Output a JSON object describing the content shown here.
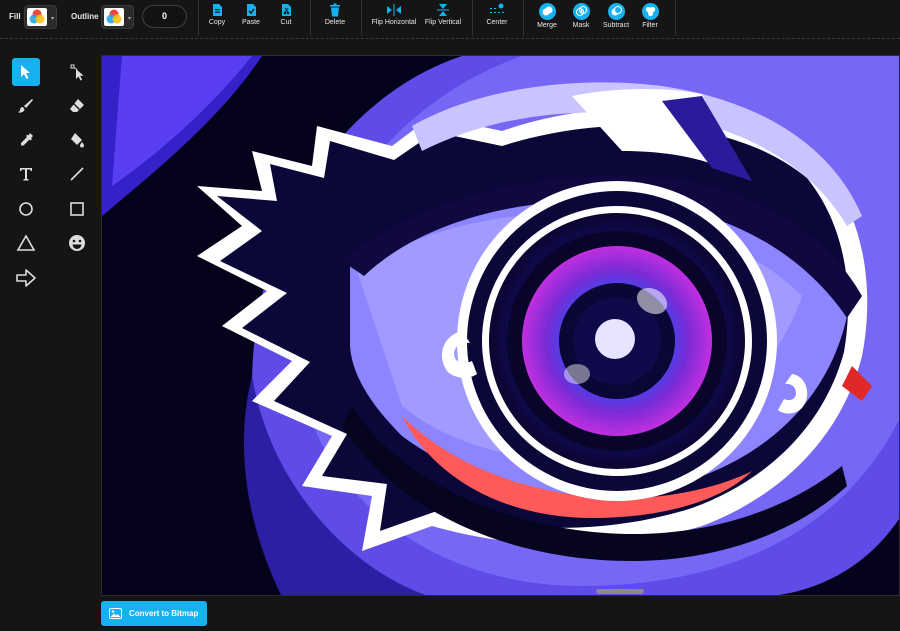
{
  "toolbar": {
    "fill_label": "Fill",
    "outline_label": "Outline",
    "outline_width": "0",
    "buttons": {
      "copy": "Copy",
      "paste": "Paste",
      "cut": "Cut",
      "delete": "Delete",
      "flip_horizontal": "Flip Horizontal",
      "flip_vertical": "Flip Vertical",
      "center": "Center",
      "merge": "Merge",
      "mask": "Mask",
      "subtract": "Subtract",
      "filter": "Filter"
    }
  },
  "tools": [
    {
      "name": "select-tool",
      "icon": "cursor-arrow-icon",
      "active": true
    },
    {
      "name": "node-edit-tool",
      "icon": "node-pointer-icon",
      "active": false
    },
    {
      "name": "brush-tool",
      "icon": "brush-icon",
      "active": false
    },
    {
      "name": "eraser-tool",
      "icon": "eraser-icon",
      "active": false
    },
    {
      "name": "eyedropper-tool",
      "icon": "eyedropper-icon",
      "active": false
    },
    {
      "name": "fill-bucket-tool",
      "icon": "paint-bucket-icon",
      "active": false
    },
    {
      "name": "text-tool",
      "icon": "text-t-icon",
      "active": false
    },
    {
      "name": "line-tool",
      "icon": "line-icon",
      "active": false
    },
    {
      "name": "circle-tool",
      "icon": "circle-icon",
      "active": false
    },
    {
      "name": "rectangle-tool",
      "icon": "square-icon",
      "active": false
    },
    {
      "name": "triangle-tool",
      "icon": "triangle-icon",
      "active": false
    },
    {
      "name": "sticker-tool",
      "icon": "smiley-icon",
      "active": false
    },
    {
      "name": "arrow-shape-tool",
      "icon": "arrow-right-icon",
      "active": false
    }
  ],
  "footer": {
    "convert_label": "Convert to Bitmap"
  },
  "colors": {
    "accent": "#17b1ef",
    "background": "#151515",
    "canvas_bg": "#03021a"
  }
}
